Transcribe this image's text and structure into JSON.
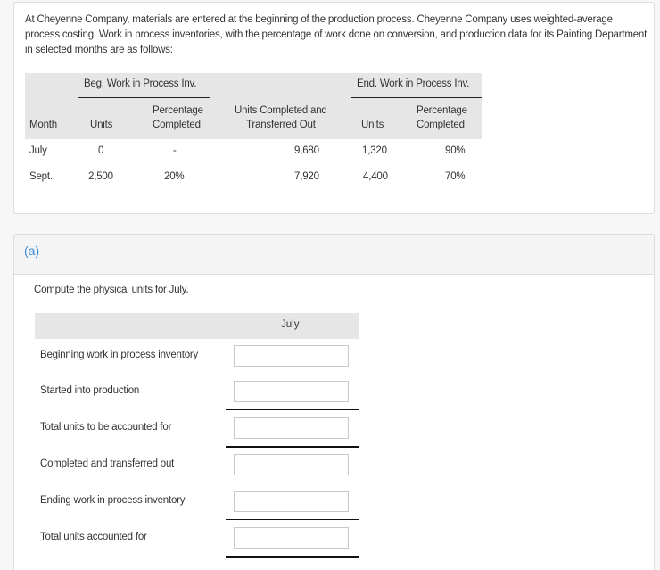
{
  "problem": {
    "intro": "At Cheyenne Company, materials are entered at the beginning of the production process. Cheyenne Company uses weighted-average process costing. Work in process inventories, with the percentage of work done on conversion, and production data for its Painting Department in selected months are as follows:",
    "table": {
      "group_headers": {
        "beg_wip": "Beg. Work in Process Inv.",
        "end_wip": "End. Work in Process Inv."
      },
      "columns": {
        "month": "Month",
        "beg_units": "Units",
        "beg_pct_line1": "Percentage",
        "beg_pct_line2": "Completed",
        "completed_line1": "Units Completed and",
        "completed_line2": "Transferred Out",
        "end_units": "Units",
        "end_pct_line1": "Percentage",
        "end_pct_line2": "Completed"
      },
      "rows": [
        {
          "month": "July",
          "beg_units": "0",
          "beg_pct": "-",
          "completed": "9,680",
          "end_units": "1,320",
          "end_pct": "90%"
        },
        {
          "month": "Sept.",
          "beg_units": "2,500",
          "beg_pct": "20%",
          "completed": "7,920",
          "end_units": "4,400",
          "end_pct": "70%"
        }
      ]
    }
  },
  "part_a": {
    "label": "(a)",
    "instruction": "Compute the physical units for July.",
    "column_header": "July",
    "rows": [
      {
        "label": "Beginning work in process inventory",
        "value": ""
      },
      {
        "label": "Started into production",
        "value": ""
      },
      {
        "label": "Total units to be accounted for",
        "value": ""
      },
      {
        "label": "Completed and transferred out",
        "value": ""
      },
      {
        "label": "Ending work in process inventory",
        "value": ""
      },
      {
        "label": "Total units accounted for",
        "value": ""
      }
    ]
  }
}
